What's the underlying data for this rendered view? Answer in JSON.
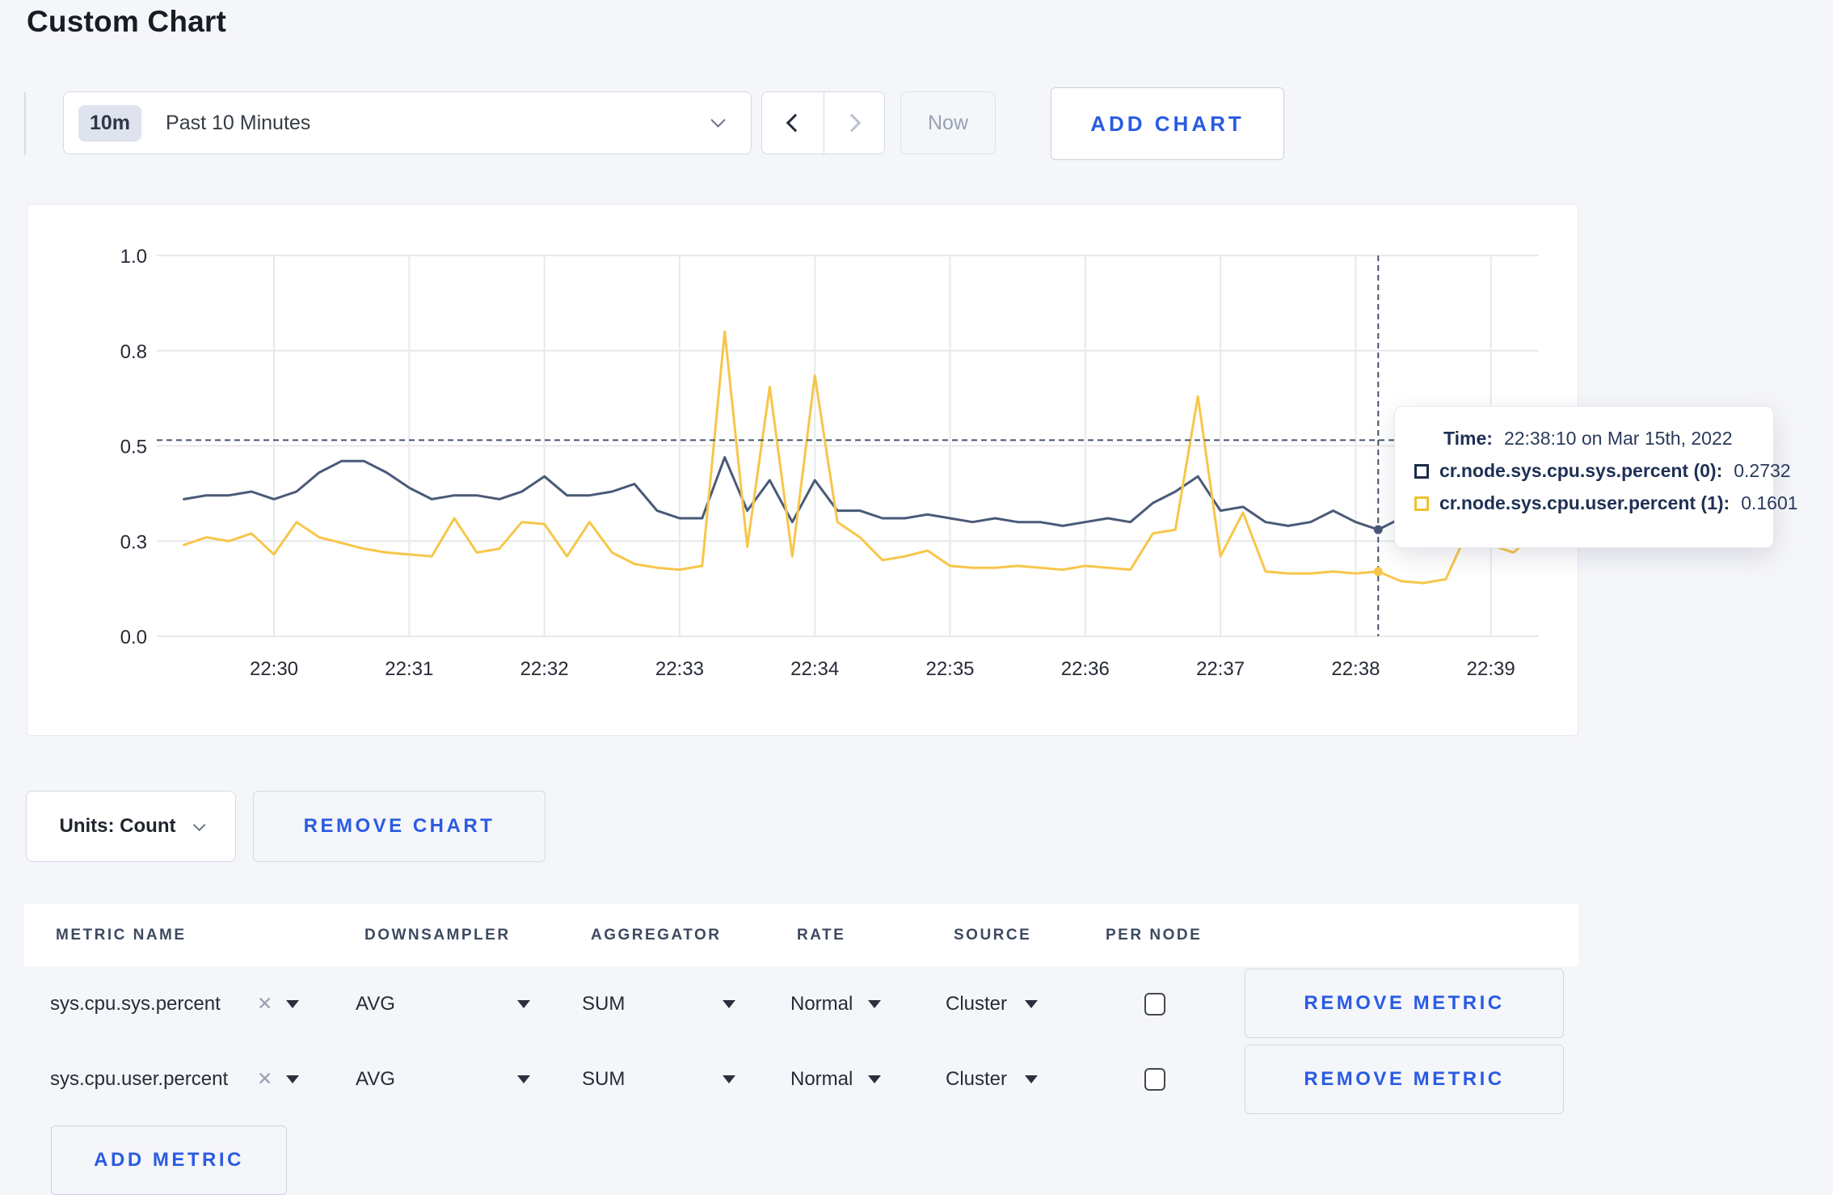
{
  "page": {
    "title": "Custom Chart",
    "background": "#f5f6fa"
  },
  "toolbar": {
    "time_badge": "10m",
    "time_range_label": "Past 10 Minutes",
    "now_label": "Now",
    "add_chart_label": "ADD CHART"
  },
  "chart_footer": {
    "units_label": "Units: Count",
    "remove_chart_label": "REMOVE CHART"
  },
  "tooltip": {
    "time_label": "Time:",
    "time_value": "22:38:10 on Mar 15th, 2022",
    "series": [
      {
        "label": "cr.node.sys.cpu.sys.percent (0):",
        "value": "0.2732",
        "swatch_color": "#1c2b4a"
      },
      {
        "label": "cr.node.sys.cpu.user.percent (1):",
        "value": "0.1601",
        "swatch_color": "#f2c02e"
      }
    ]
  },
  "metrics_table": {
    "headers": [
      "METRIC NAME",
      "DOWNSAMPLER",
      "AGGREGATOR",
      "RATE",
      "SOURCE",
      "PER NODE"
    ],
    "rows": [
      {
        "metric": "sys.cpu.sys.percent",
        "downsampler": "AVG",
        "aggregator": "SUM",
        "rate": "Normal",
        "source": "Cluster",
        "per_node_checked": false,
        "remove_label": "REMOVE METRIC"
      },
      {
        "metric": "sys.cpu.user.percent",
        "downsampler": "AVG",
        "aggregator": "SUM",
        "rate": "Normal",
        "source": "Cluster",
        "per_node_checked": false,
        "remove_label": "REMOVE METRIC"
      }
    ],
    "add_metric_label": "ADD METRIC"
  },
  "chart_data": {
    "type": "line",
    "title": "",
    "xlabel": "",
    "ylabel": "",
    "ylim": [
      0,
      1
    ],
    "grid": true,
    "legend_position": "tooltip",
    "yticks": [
      {
        "value": 0.0,
        "label": "0.0"
      },
      {
        "value": 0.25,
        "label": "0.3"
      },
      {
        "value": 0.5,
        "label": "0.5"
      },
      {
        "value": 0.75,
        "label": "0.8"
      },
      {
        "value": 1.0,
        "label": "1.0"
      }
    ],
    "x_minute_labels": [
      "22:30",
      "22:31",
      "22:32",
      "22:33",
      "22:34",
      "22:35",
      "22:36",
      "22:37",
      "22:38",
      "22:39"
    ],
    "points_start_time": "22:29:20",
    "point_interval_seconds": 10,
    "first_label_point_index": 4,
    "points_per_minute": 6,
    "series": [
      {
        "name": "cr.node.sys.cpu.sys.percent",
        "color": "#4a5a78",
        "values": [
          0.36,
          0.37,
          0.37,
          0.38,
          0.36,
          0.38,
          0.43,
          0.46,
          0.46,
          0.43,
          0.39,
          0.36,
          0.37,
          0.37,
          0.36,
          0.38,
          0.42,
          0.37,
          0.37,
          0.38,
          0.4,
          0.33,
          0.31,
          0.31,
          0.47,
          0.33,
          0.41,
          0.3,
          0.41,
          0.33,
          0.33,
          0.31,
          0.31,
          0.32,
          0.31,
          0.3,
          0.31,
          0.3,
          0.3,
          0.29,
          0.3,
          0.31,
          0.3,
          0.35,
          0.38,
          0.42,
          0.33,
          0.34,
          0.3,
          0.29,
          0.3,
          0.33,
          0.3,
          0.28,
          0.31,
          0.3,
          0.3,
          0.31,
          0.3,
          0.31,
          0.3
        ]
      },
      {
        "name": "cr.node.sys.cpu.user.percent",
        "color": "#f7c64a",
        "values": [
          0.24,
          0.26,
          0.25,
          0.27,
          0.215,
          0.3,
          0.26,
          0.245,
          0.23,
          0.22,
          0.215,
          0.21,
          0.31,
          0.22,
          0.23,
          0.3,
          0.295,
          0.21,
          0.3,
          0.22,
          0.19,
          0.18,
          0.175,
          0.185,
          0.8,
          0.235,
          0.655,
          0.21,
          0.685,
          0.3,
          0.26,
          0.2,
          0.21,
          0.225,
          0.185,
          0.18,
          0.18,
          0.185,
          0.18,
          0.175,
          0.185,
          0.18,
          0.175,
          0.27,
          0.28,
          0.63,
          0.21,
          0.325,
          0.17,
          0.165,
          0.165,
          0.17,
          0.165,
          0.17,
          0.145,
          0.14,
          0.15,
          0.28,
          0.24,
          0.22,
          0.27
        ]
      }
    ],
    "crosshair": {
      "point_index": 53,
      "time": "22:38:10",
      "y_value": 0.515,
      "sys_value": 0.2732,
      "user_value": 0.1601
    }
  }
}
